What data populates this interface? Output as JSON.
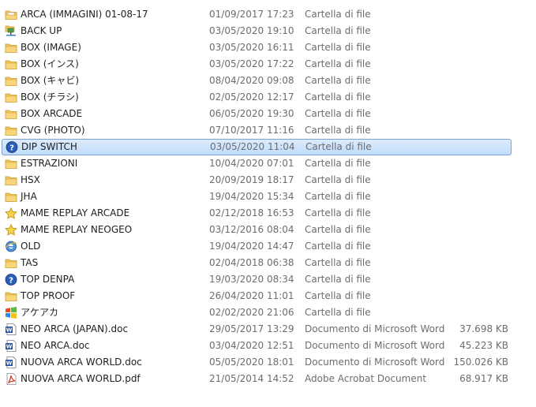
{
  "colors": {
    "folder": "#e8b84a",
    "selection_border": "#7da2ce",
    "selection_fill": "#cce1fb",
    "secondary_text": "#6d6d6d"
  },
  "files": [
    {
      "name": "ARCA (IMMAGINI) 01-08-17",
      "date": "01/09/2017 17:23",
      "type": "Cartella di file",
      "size": "",
      "icon": "folder-image-icon"
    },
    {
      "name": "BACK UP",
      "date": "03/05/2020 19:10",
      "type": "Cartella di file",
      "size": "",
      "icon": "network-folder-icon"
    },
    {
      "name": "BOX (IMAGE)",
      "date": "03/05/2020 16:11",
      "type": "Cartella di file",
      "size": "",
      "icon": "folder-icon"
    },
    {
      "name": "BOX (インス)",
      "date": "03/05/2020 17:22",
      "type": "Cartella di file",
      "size": "",
      "icon": "folder-icon"
    },
    {
      "name": "BOX (キャビ)",
      "date": "08/04/2020 09:08",
      "type": "Cartella di file",
      "size": "",
      "icon": "folder-icon"
    },
    {
      "name": "BOX (チラシ)",
      "date": "02/05/2020 12:17",
      "type": "Cartella di file",
      "size": "",
      "icon": "folder-icon"
    },
    {
      "name": "BOX ARCADE",
      "date": "06/05/2020 19:30",
      "type": "Cartella di file",
      "size": "",
      "icon": "folder-icon"
    },
    {
      "name": "CVG (PHOTO)",
      "date": "07/10/2017 11:16",
      "type": "Cartella di file",
      "size": "",
      "icon": "folder-icon"
    },
    {
      "name": "DIP SWITCH",
      "date": "03/05/2020 11:04",
      "type": "Cartella di file",
      "size": "",
      "icon": "help-icon",
      "selected": true
    },
    {
      "name": "ESTRAZIONI",
      "date": "10/04/2020 07:01",
      "type": "Cartella di file",
      "size": "",
      "icon": "folder-icon"
    },
    {
      "name": "HSX",
      "date": "20/09/2019 18:17",
      "type": "Cartella di file",
      "size": "",
      "icon": "folder-icon"
    },
    {
      "name": "JHA",
      "date": "19/04/2020 15:34",
      "type": "Cartella di file",
      "size": "",
      "icon": "folder-icon"
    },
    {
      "name": "MAME REPLAY ARCADE",
      "date": "02/12/2018 16:53",
      "type": "Cartella di file",
      "size": "",
      "icon": "star-icon"
    },
    {
      "name": "MAME REPLAY NEOGEO",
      "date": "03/12/2016 08:04",
      "type": "Cartella di file",
      "size": "",
      "icon": "star-icon"
    },
    {
      "name": "OLD",
      "date": "19/04/2020 14:47",
      "type": "Cartella di file",
      "size": "",
      "icon": "internet-explorer-icon"
    },
    {
      "name": "TAS",
      "date": "02/04/2018 06:38",
      "type": "Cartella di file",
      "size": "",
      "icon": "folder-icon"
    },
    {
      "name": "TOP DENPA",
      "date": "19/03/2020 08:34",
      "type": "Cartella di file",
      "size": "",
      "icon": "help-icon"
    },
    {
      "name": "TOP PROOF",
      "date": "26/04/2020 11:01",
      "type": "Cartella di file",
      "size": "",
      "icon": "folder-icon"
    },
    {
      "name": "アケアカ",
      "date": "02/02/2020 21:06",
      "type": "Cartella di file",
      "size": "",
      "icon": "windows-logo-icon"
    },
    {
      "name": "NEO ARCA (JAPAN).doc",
      "date": "29/05/2017 13:29",
      "type": "Documento di Microsoft Word",
      "size": "37.698 KB",
      "icon": "word-document-icon"
    },
    {
      "name": "NEO ARCA.doc",
      "date": "03/04/2020 12:51",
      "type": "Documento di Microsoft Word",
      "size": "45.223 KB",
      "icon": "word-document-icon"
    },
    {
      "name": "NUOVA ARCA WORLD.doc",
      "date": "05/05/2020 18:01",
      "type": "Documento di Microsoft Word",
      "size": "150.026 KB",
      "icon": "word-document-icon"
    },
    {
      "name": "NUOVA ARCA WORLD.pdf",
      "date": "21/05/2014 14:52",
      "type": "Adobe Acrobat Document",
      "size": "68.917 KB",
      "icon": "pdf-document-icon"
    }
  ]
}
